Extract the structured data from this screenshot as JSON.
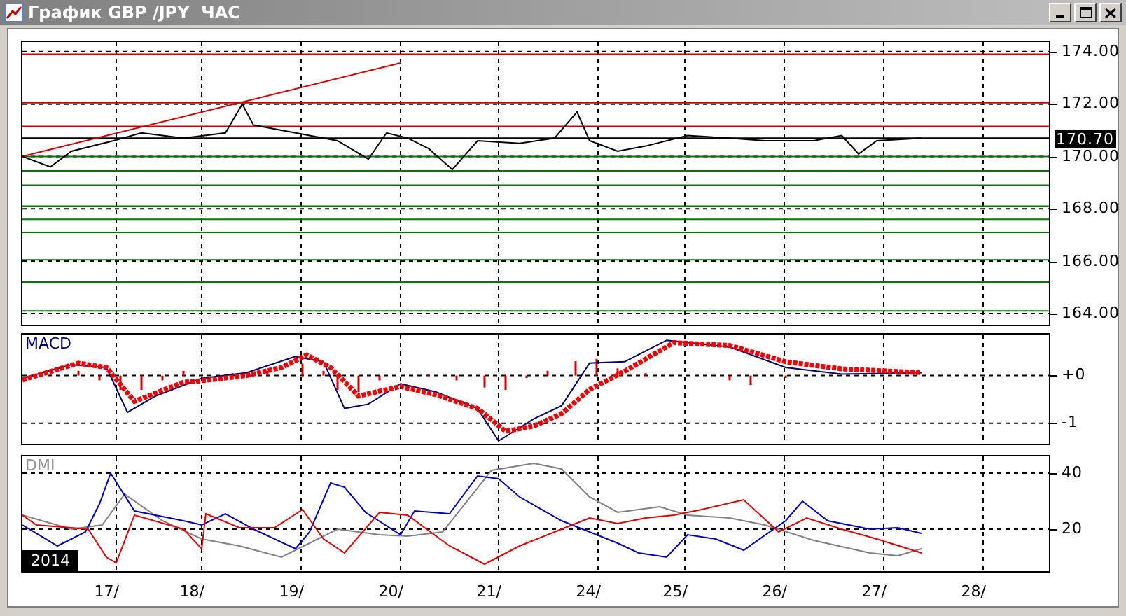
{
  "window": {
    "title": "График GBP /JPY  ЧАС"
  },
  "price_panel": {
    "axis_labels": [
      "174.00",
      "172.00",
      "170.00",
      "168.00",
      "166.00",
      "164.00"
    ],
    "current_price": "170.70"
  },
  "macd_panel": {
    "title": "MACD",
    "axis_labels": [
      "+0",
      "-1"
    ]
  },
  "dmi_panel": {
    "title": "DMI",
    "axis_labels": [
      "40",
      "20"
    ],
    "year": "2014"
  },
  "date_axis": {
    "labels": [
      "17/",
      "18/",
      "19/",
      "20/",
      "21/",
      "24/",
      "25/",
      "26/",
      "27/",
      "28/"
    ]
  }
}
